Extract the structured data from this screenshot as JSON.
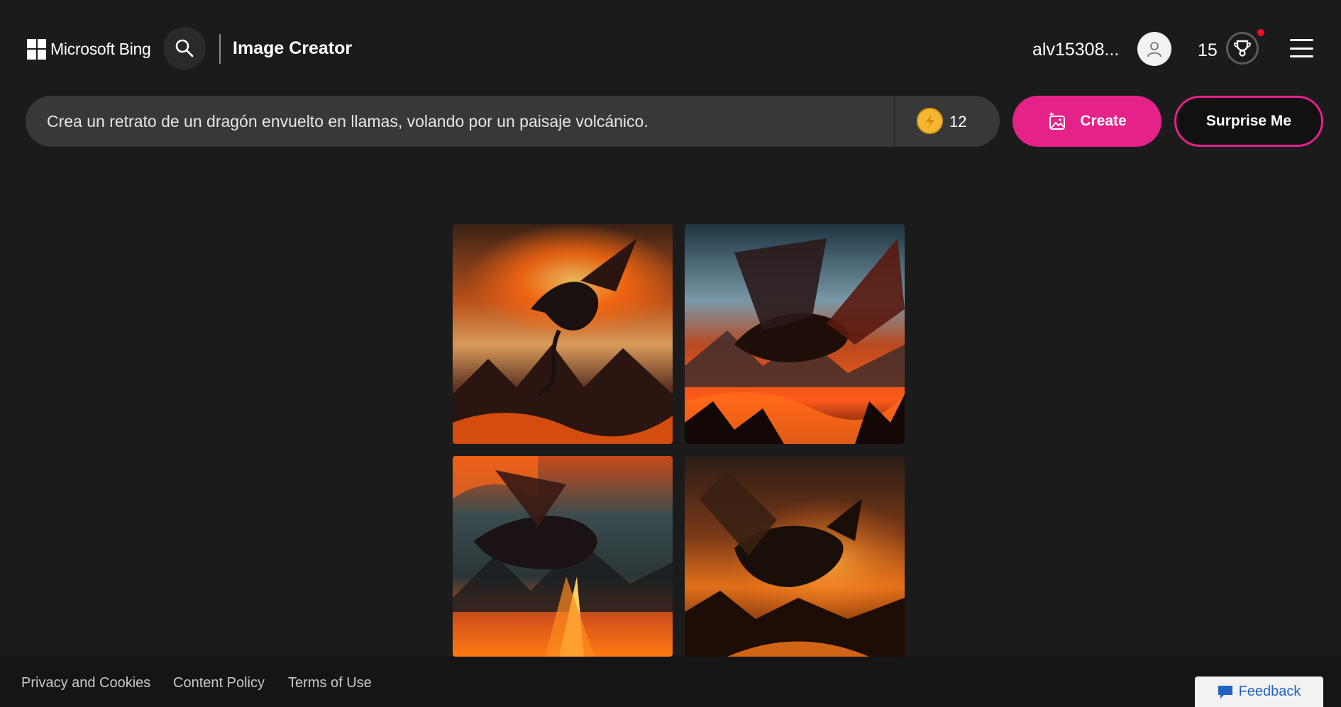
{
  "header": {
    "brand": "Microsoft Bing",
    "app_title": "Image Creator",
    "username": "alv15308...",
    "points": "15"
  },
  "prompt": {
    "text": "Crea un retrato de un dragón envuelto en llamas, volando por un paisaje volcánico.",
    "boosts": "12"
  },
  "actions": {
    "create_label": "Create",
    "surprise_label": "Surprise Me"
  },
  "images": [
    {
      "name": "generated-image-1",
      "sky": "#3a2a1e",
      "fire": "#ff6a10"
    },
    {
      "name": "generated-image-2",
      "sky": "#3d5a68",
      "fire": "#ff5a1a"
    },
    {
      "name": "generated-image-3",
      "sky": "#2e3d40",
      "fire": "#ff7a14"
    },
    {
      "name": "generated-image-4",
      "sky": "#3a2418",
      "fire": "#ff8a20"
    }
  ],
  "footer": {
    "privacy": "Privacy and Cookies",
    "content_policy": "Content Policy",
    "terms": "Terms of Use",
    "feedback": "Feedback"
  },
  "colors": {
    "background": "#1b1b1b",
    "accent": "#e5218a",
    "prompt_bg": "#383838",
    "coin": "#f5b731"
  }
}
